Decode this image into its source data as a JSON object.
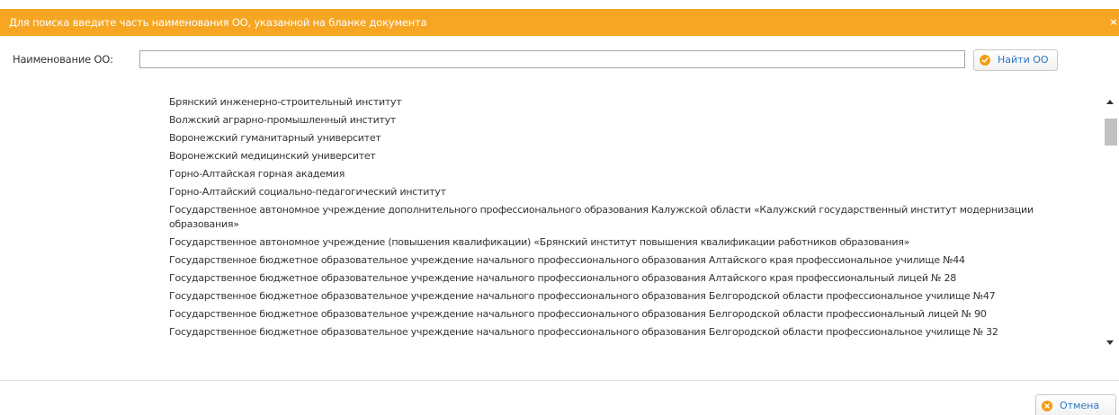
{
  "dialog": {
    "title": "Для поиска введите часть наименования ОО, указанной на бланке документа",
    "close_glyph": "×",
    "colors": {
      "title_bar": "#f6a623",
      "accent_orange": "#f39c12",
      "link_blue": "#2a76c6",
      "cancel_red": "#e74c3c"
    }
  },
  "search": {
    "label": "Наименование ОО:",
    "value": "",
    "placeholder": ""
  },
  "buttons": {
    "find_label": "Найти ОО",
    "find_icon": "check-circle-icon",
    "cancel_label": "Отмена",
    "cancel_icon": "x-circle-icon"
  },
  "results": {
    "items": [
      "Брянский инженерно-строительный институт",
      "Волжский аграрно-промышленный институт",
      "Воронежский гуманитарный университет",
      "Воронежский медицинский университет",
      "Горно-Алтайская горная академия",
      "Горно-Алтайский социально-педагогический институт",
      "Государственное автономное учреждение дополнительного профессионального образования Калужской области «Калужский государственный институт модернизации образования»",
      "Государственное автономное учреждение (повышения квалификации) «Брянский институт повышения квалификации работников образования»",
      "Государственное бюджетное образовательное учреждение начального профессионального образования Алтайского края профессиональное училище №44",
      "Государственное бюджетное образовательное учреждение начального профессионального образования Алтайского края профессиональный лицей № 28",
      "Государственное бюджетное образовательное учреждение начального профессионального образования Белгородской области профессиональное училище №47",
      "Государственное бюджетное образовательное учреждение начального профессионального образования Белгородской области профессиональный лицей № 90",
      "Государственное бюджетное образовательное учреждение начального профессионального образования Белгородской области профессиональное училище № 32"
    ]
  }
}
